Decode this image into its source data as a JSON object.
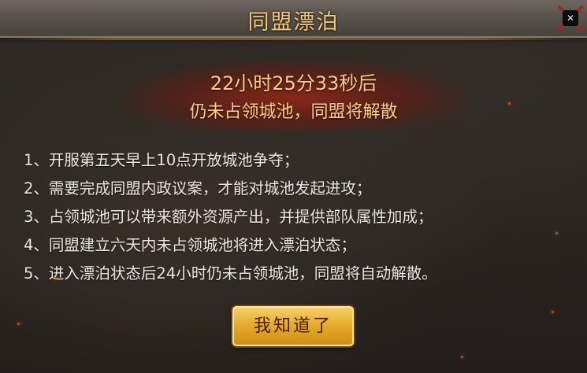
{
  "dialog": {
    "title": "同盟漂泊",
    "close_icon": "close-icon",
    "countdown_time": "22小时25分33秒后",
    "countdown_message": "仍未占领城池，同盟将解散",
    "rules": [
      "1、开服第五天早上10点开放城池争夺；",
      "2、需要完成同盟内政议案，才能对城池发起进攻；",
      "3、占领城池可以带来额外资源产出，并提供部队属性加成；",
      "4、同盟建立六天内未占领城池将进入漂泊状态；",
      "5、进入漂泊状态后24小时仍未占领城池，同盟将自动解散。"
    ],
    "confirm_label": "我知道了"
  },
  "colors": {
    "title_gold": "#f3c77a",
    "countdown_gold": "#f6cf8c",
    "band_red": "#962616",
    "button_gold": "#e6ac2e",
    "text": "#ece7df"
  }
}
